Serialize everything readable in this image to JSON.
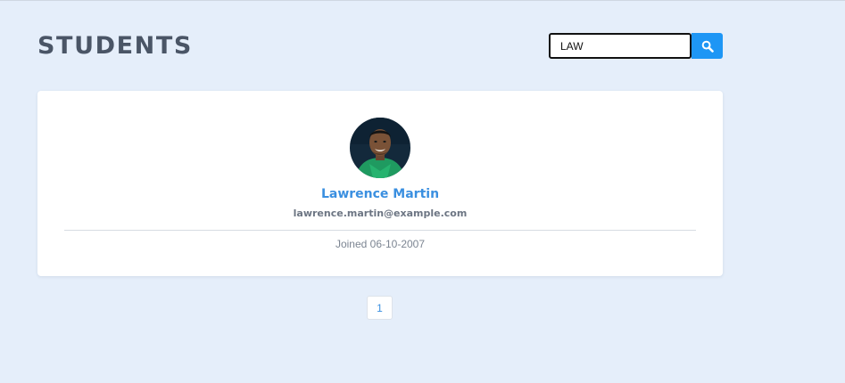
{
  "header": {
    "title": "STUDENTS"
  },
  "search": {
    "value": "LAW",
    "button_icon": "search-icon",
    "button_color": "#1e96f5"
  },
  "student": {
    "name": "Lawrence Martin",
    "email": "lawrence.martin@example.com",
    "joined": "Joined 06-10-2007",
    "avatar_icon": "avatar"
  },
  "pagination": {
    "pages": [
      "1"
    ],
    "current": "1"
  },
  "colors": {
    "background": "#e5eefa",
    "accent": "#3a8fe0",
    "title": "#4a5566"
  }
}
